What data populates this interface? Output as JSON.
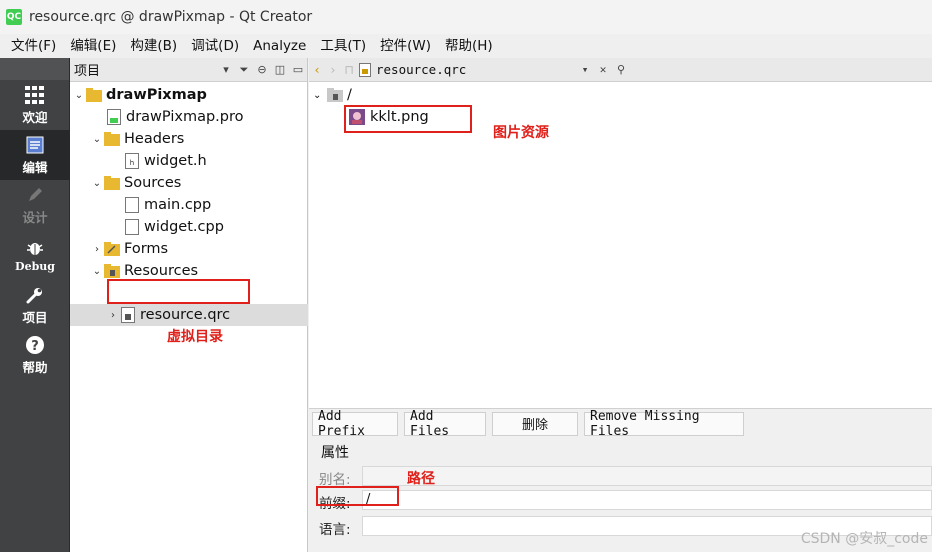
{
  "window": {
    "title": "resource.qrc @ drawPixmap - Qt Creator",
    "logo": "QC"
  },
  "menu": [
    "文件(F)",
    "编辑(E)",
    "构建(B)",
    "调试(D)",
    "Analyze",
    "工具(T)",
    "控件(W)",
    "帮助(H)"
  ],
  "modes": [
    {
      "label": "欢迎",
      "icon": "grid-icon"
    },
    {
      "label": "编辑",
      "icon": "edit-icon"
    },
    {
      "label": "设计",
      "icon": "pencil-icon"
    },
    {
      "label": "Debug",
      "icon": "bug-icon"
    },
    {
      "label": "项目",
      "icon": "wrench-icon"
    },
    {
      "label": "帮助",
      "icon": "help-icon"
    }
  ],
  "project_panel": {
    "title": "项目",
    "tree": [
      {
        "label": "drawPixmap",
        "bold": true
      },
      {
        "label": "drawPixmap.pro"
      },
      {
        "label": "Headers"
      },
      {
        "label": "widget.h"
      },
      {
        "label": "Sources"
      },
      {
        "label": "main.cpp"
      },
      {
        "label": "widget.cpp"
      },
      {
        "label": "Forms"
      },
      {
        "label": "Resources"
      },
      {
        "label": "resource.qrc"
      }
    ]
  },
  "editor": {
    "open_file": "resource.qrc",
    "root_prefix": "/",
    "resource_file": "kklt.png",
    "buttons": {
      "add_prefix": "Add Prefix",
      "add_files": "Add Files",
      "delete": "删除",
      "remove_missing": "Remove Missing Files"
    },
    "properties": {
      "title": "属性",
      "alias_label": "别名:",
      "prefix_label": "前缀:",
      "prefix_value": "/",
      "lang_label": "语言:"
    }
  },
  "annotations": {
    "image_resource": "图片资源",
    "virtual_dir": "虚拟目录",
    "path": "路径"
  },
  "watermark": "CSDN @安叔_code",
  "colors": {
    "annotation_red": "#e0201a",
    "qt_green": "#41cd52",
    "mode_bar": "#404244"
  }
}
